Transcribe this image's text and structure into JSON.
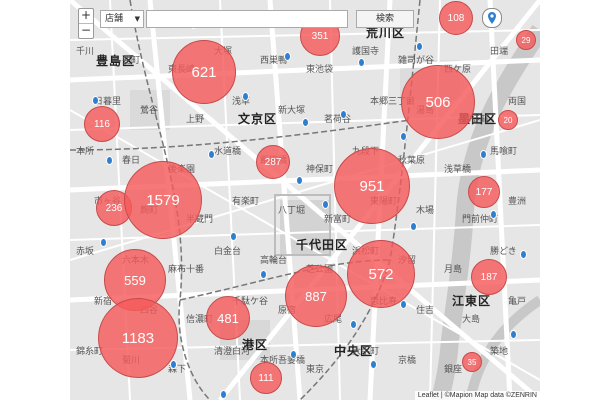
{
  "search": {
    "category": "店舗",
    "button": "検索",
    "placeholder": ""
  },
  "zoom": {
    "plus": "+",
    "minus": "−"
  },
  "wards": [
    {
      "name": "豊島区"
    },
    {
      "name": "荒川区"
    },
    {
      "name": "文京区"
    },
    {
      "name": "墨田区"
    },
    {
      "name": "千代田区"
    },
    {
      "name": "江東区"
    },
    {
      "name": "中央区"
    },
    {
      "name": "港区"
    }
  ],
  "place_labels": [
    "千川",
    "要町",
    "東長崎",
    "大塚",
    "西巣鴨",
    "東池袋",
    "護国寺",
    "雑司が谷",
    "西ケ原",
    "田端",
    "日暮里",
    "鶯谷",
    "上野",
    "浅草",
    "新大塚",
    "茗荷谷",
    "本郷三丁目",
    "湯島",
    "御徒町",
    "両国",
    "本所",
    "春日",
    "後楽園",
    "水道橋",
    "飯田橋",
    "神保町",
    "九段下",
    "秋葉原",
    "浅草橋",
    "馬喰町",
    "市ヶ谷",
    "麹町",
    "半蔵門",
    "有楽町",
    "八丁堀",
    "新富町",
    "東陽町",
    "木場",
    "門前仲町",
    "豊洲",
    "赤坂",
    "六本木",
    "麻布十番",
    "白金台",
    "高輪台",
    "芝公園",
    "浜松町",
    "汐留",
    "月島",
    "勝どき",
    "新宿",
    "四谷",
    "信濃町",
    "千駄ケ谷",
    "原宿",
    "広尾",
    "恵比寿",
    "住吉",
    "大島",
    "亀戸",
    "錦糸町",
    "菊川",
    "森下",
    "清澄白河",
    "本所吾妻橋",
    "東京",
    "大手町",
    "京橋",
    "銀座",
    "築地"
  ],
  "clusters": [
    {
      "count": "351",
      "value": 351
    },
    {
      "count": "108",
      "value": 108
    },
    {
      "count": "29",
      "value": 29
    },
    {
      "count": "621",
      "value": 621
    },
    {
      "count": "506",
      "value": 506
    },
    {
      "count": "116",
      "value": 116
    },
    {
      "count": "20",
      "value": 20
    },
    {
      "count": "287",
      "value": 287
    },
    {
      "count": "951",
      "value": 951
    },
    {
      "count": "177",
      "value": 177
    },
    {
      "count": "236",
      "value": 236
    },
    {
      "count": "1579",
      "value": 1579
    },
    {
      "count": "572",
      "value": 572
    },
    {
      "count": "187",
      "value": 187
    },
    {
      "count": "559",
      "value": 559
    },
    {
      "count": "887",
      "value": 887
    },
    {
      "count": "481",
      "value": 481
    },
    {
      "count": "1183",
      "value": 1183
    },
    {
      "count": "111",
      "value": 111
    },
    {
      "count": "35",
      "value": 35
    }
  ],
  "attribution": "Leaflet | ©Mapion Map data ©ZENRIN",
  "colors": {
    "bubble_fill": "#f55a5a",
    "bubble_border": "#c74a4a",
    "map_background": "#e7e7e7",
    "poi_pin": "#2f7fd1"
  }
}
